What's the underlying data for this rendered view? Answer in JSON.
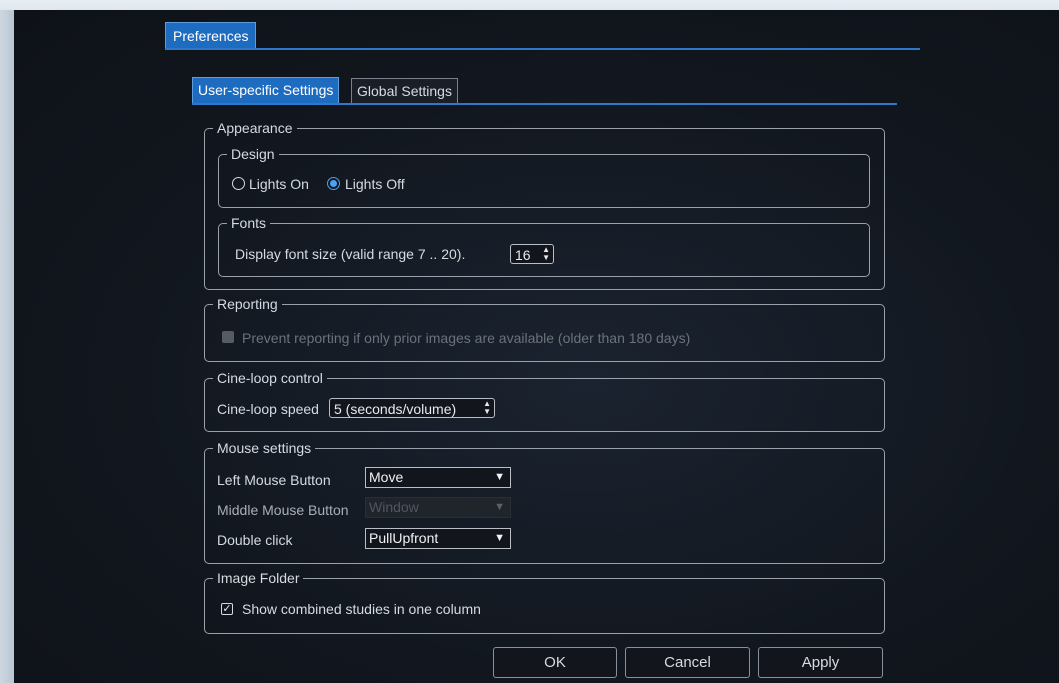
{
  "tabs": {
    "main": "Preferences",
    "user": "User-specific Settings",
    "global": "Global Settings"
  },
  "appearance": {
    "legend": "Appearance",
    "design": {
      "legend": "Design",
      "lights_on": "Lights On",
      "lights_off": "Lights Off",
      "selected": "Lights Off"
    },
    "fonts": {
      "legend": "Fonts",
      "label": "Display font size (valid range 7 .. 20).",
      "value": "16"
    }
  },
  "reporting": {
    "legend": "Reporting",
    "prevent_label": "Prevent reporting if only prior images are available (older than 180 days)"
  },
  "cine": {
    "legend": "Cine-loop control",
    "label": "Cine-loop speed",
    "value": "5 (seconds/volume)"
  },
  "mouse": {
    "legend": "Mouse settings",
    "left_label": "Left Mouse Button",
    "left_value": "Move",
    "middle_label": "Middle Mouse Button",
    "middle_value": "Window",
    "double_label": "Double click",
    "double_value": "PullUpfront"
  },
  "image_folder": {
    "legend": "Image Folder",
    "combined_label": "Show combined studies in one column"
  },
  "buttons": {
    "ok": "OK",
    "cancel": "Cancel",
    "apply": "Apply"
  },
  "icons": {
    "spin": "up-down-spinner-icon",
    "caret": "chevron-down-icon",
    "check": "checkmark-icon"
  },
  "colors": {
    "accent": "#1e6cc0",
    "background": "#12171f",
    "border": "#9aa1aa"
  }
}
